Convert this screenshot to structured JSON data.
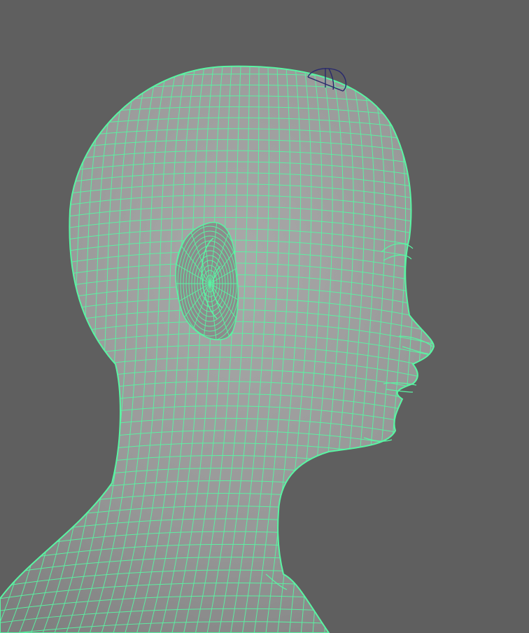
{
  "viewport": {
    "background_color": "#5f5f5f",
    "mesh_fill_color": "#9a9a9a",
    "wireframe_color": "#59f5a3",
    "manipulator_color": "#2a2a6e",
    "mesh_object": "head-and-neck-mesh",
    "selection_state": "selected-wireframe-on-shaded",
    "manipulator_icon": "transform-manipulator-icon"
  }
}
